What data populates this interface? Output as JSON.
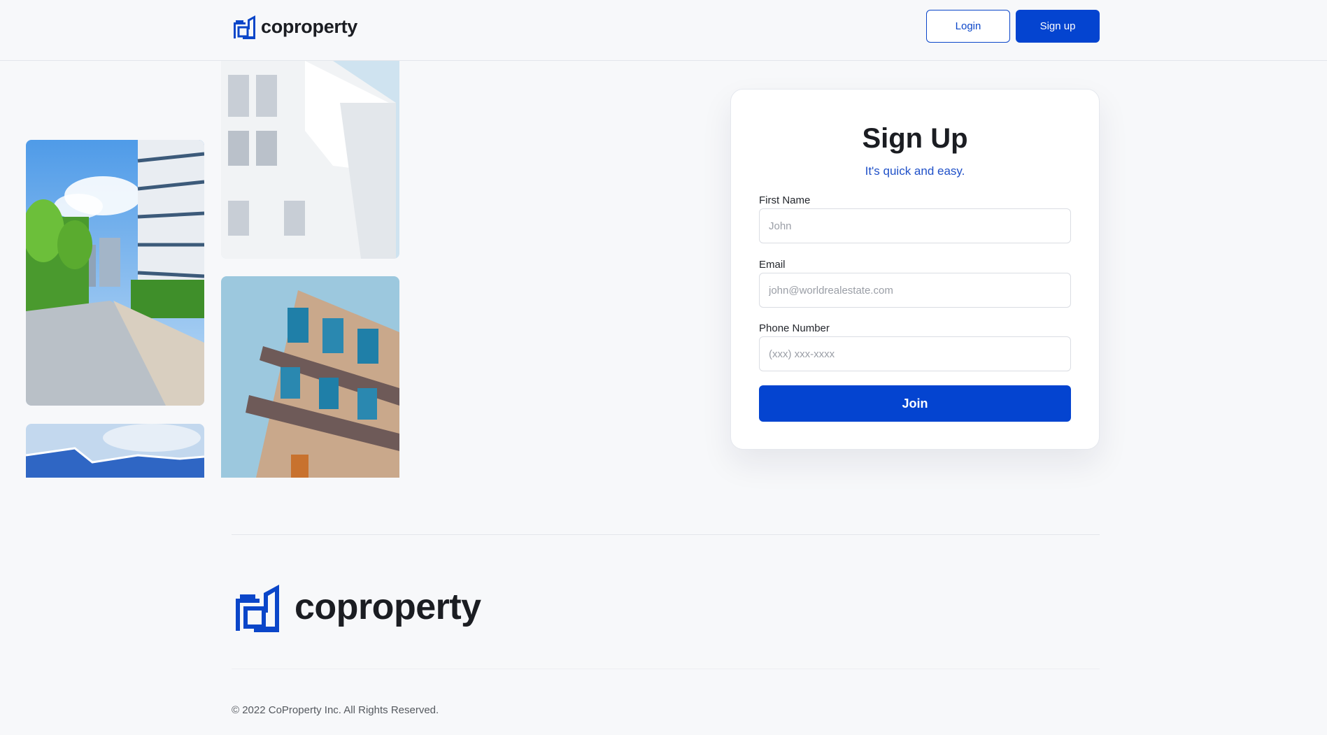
{
  "brand": {
    "name": "coproperty",
    "color": "#0444d0"
  },
  "header": {
    "login_label": "Login",
    "signup_label": "Sign up"
  },
  "gallery": {
    "images": [
      "building-walkway-photo",
      "white-facade-photo",
      "apartment-balconies-photo",
      "glass-roof-photo"
    ]
  },
  "form": {
    "title": "Sign Up",
    "subtitle": "It's quick and easy.",
    "first_name": {
      "label": "First Name",
      "placeholder": "John",
      "value": ""
    },
    "email": {
      "label": "Email",
      "placeholder": "john@worldrealestate.com",
      "value": ""
    },
    "phone": {
      "label": "Phone Number",
      "placeholder": "(xxx) xxx-xxxx",
      "value": ""
    },
    "submit_label": "Join"
  },
  "footer": {
    "brand_name": "coproperty",
    "copyright": "© 2022 CoProperty Inc. All Rights Reserved."
  }
}
